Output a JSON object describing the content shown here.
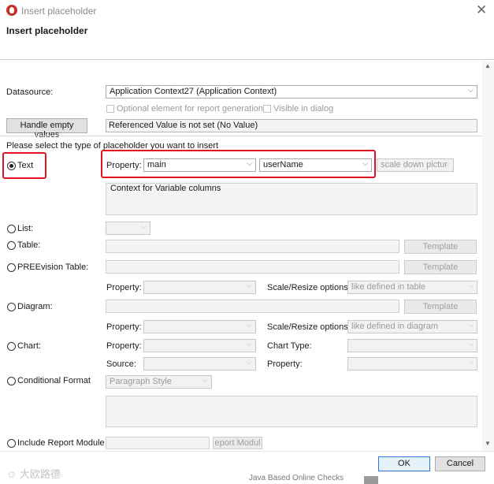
{
  "window": {
    "title": "Insert placeholder",
    "header_title": "Insert placeholder"
  },
  "datasource": {
    "label": "Datasource:",
    "value": "Application Context27 (Application Context)",
    "optional_label": "Optional element for report generation",
    "visible_label": "Visible in dialog"
  },
  "empty": {
    "button": "Handle empty values",
    "value": "Referenced Value is not set (No Value)"
  },
  "select_prompt": "Please select the type of placeholder you want to insert",
  "text": {
    "radio_label": "Text",
    "property_label": "Property:",
    "property_value": "main",
    "attribute_value": "userName",
    "scale_value": "scale down pictur",
    "context_text": "Context for Variable columns"
  },
  "list": {
    "label": "List:"
  },
  "table": {
    "label": "Table:",
    "template": "Template"
  },
  "preevision": {
    "label": "PREEvision Table:",
    "template": "Template",
    "property_label": "Property:",
    "scale_label": "Scale/Resize options:",
    "scale_value": "like defined in table"
  },
  "diagram": {
    "label": "Diagram:",
    "template": "Template",
    "property_label": "Property:",
    "scale_label": "Scale/Resize options:",
    "scale_value": "like defined in diagram"
  },
  "chart": {
    "label": "Chart:",
    "property_label": "Property:",
    "type_label": "Chart Type:",
    "source_label": "Source:",
    "property2_label": "Property:"
  },
  "conditional": {
    "label": "Conditional Format",
    "style_value": "Paragraph Style"
  },
  "include": {
    "label": "Include Report Module",
    "button": "eport Modul"
  },
  "buttons": {
    "ok": "OK",
    "cancel": "Cancel"
  },
  "background": {
    "behind_text": "Java Based Online Checks",
    "watermark": "大欧路德"
  },
  "colors": {
    "highlight": "#e0141e",
    "ok_border": "#2d7ad6"
  }
}
